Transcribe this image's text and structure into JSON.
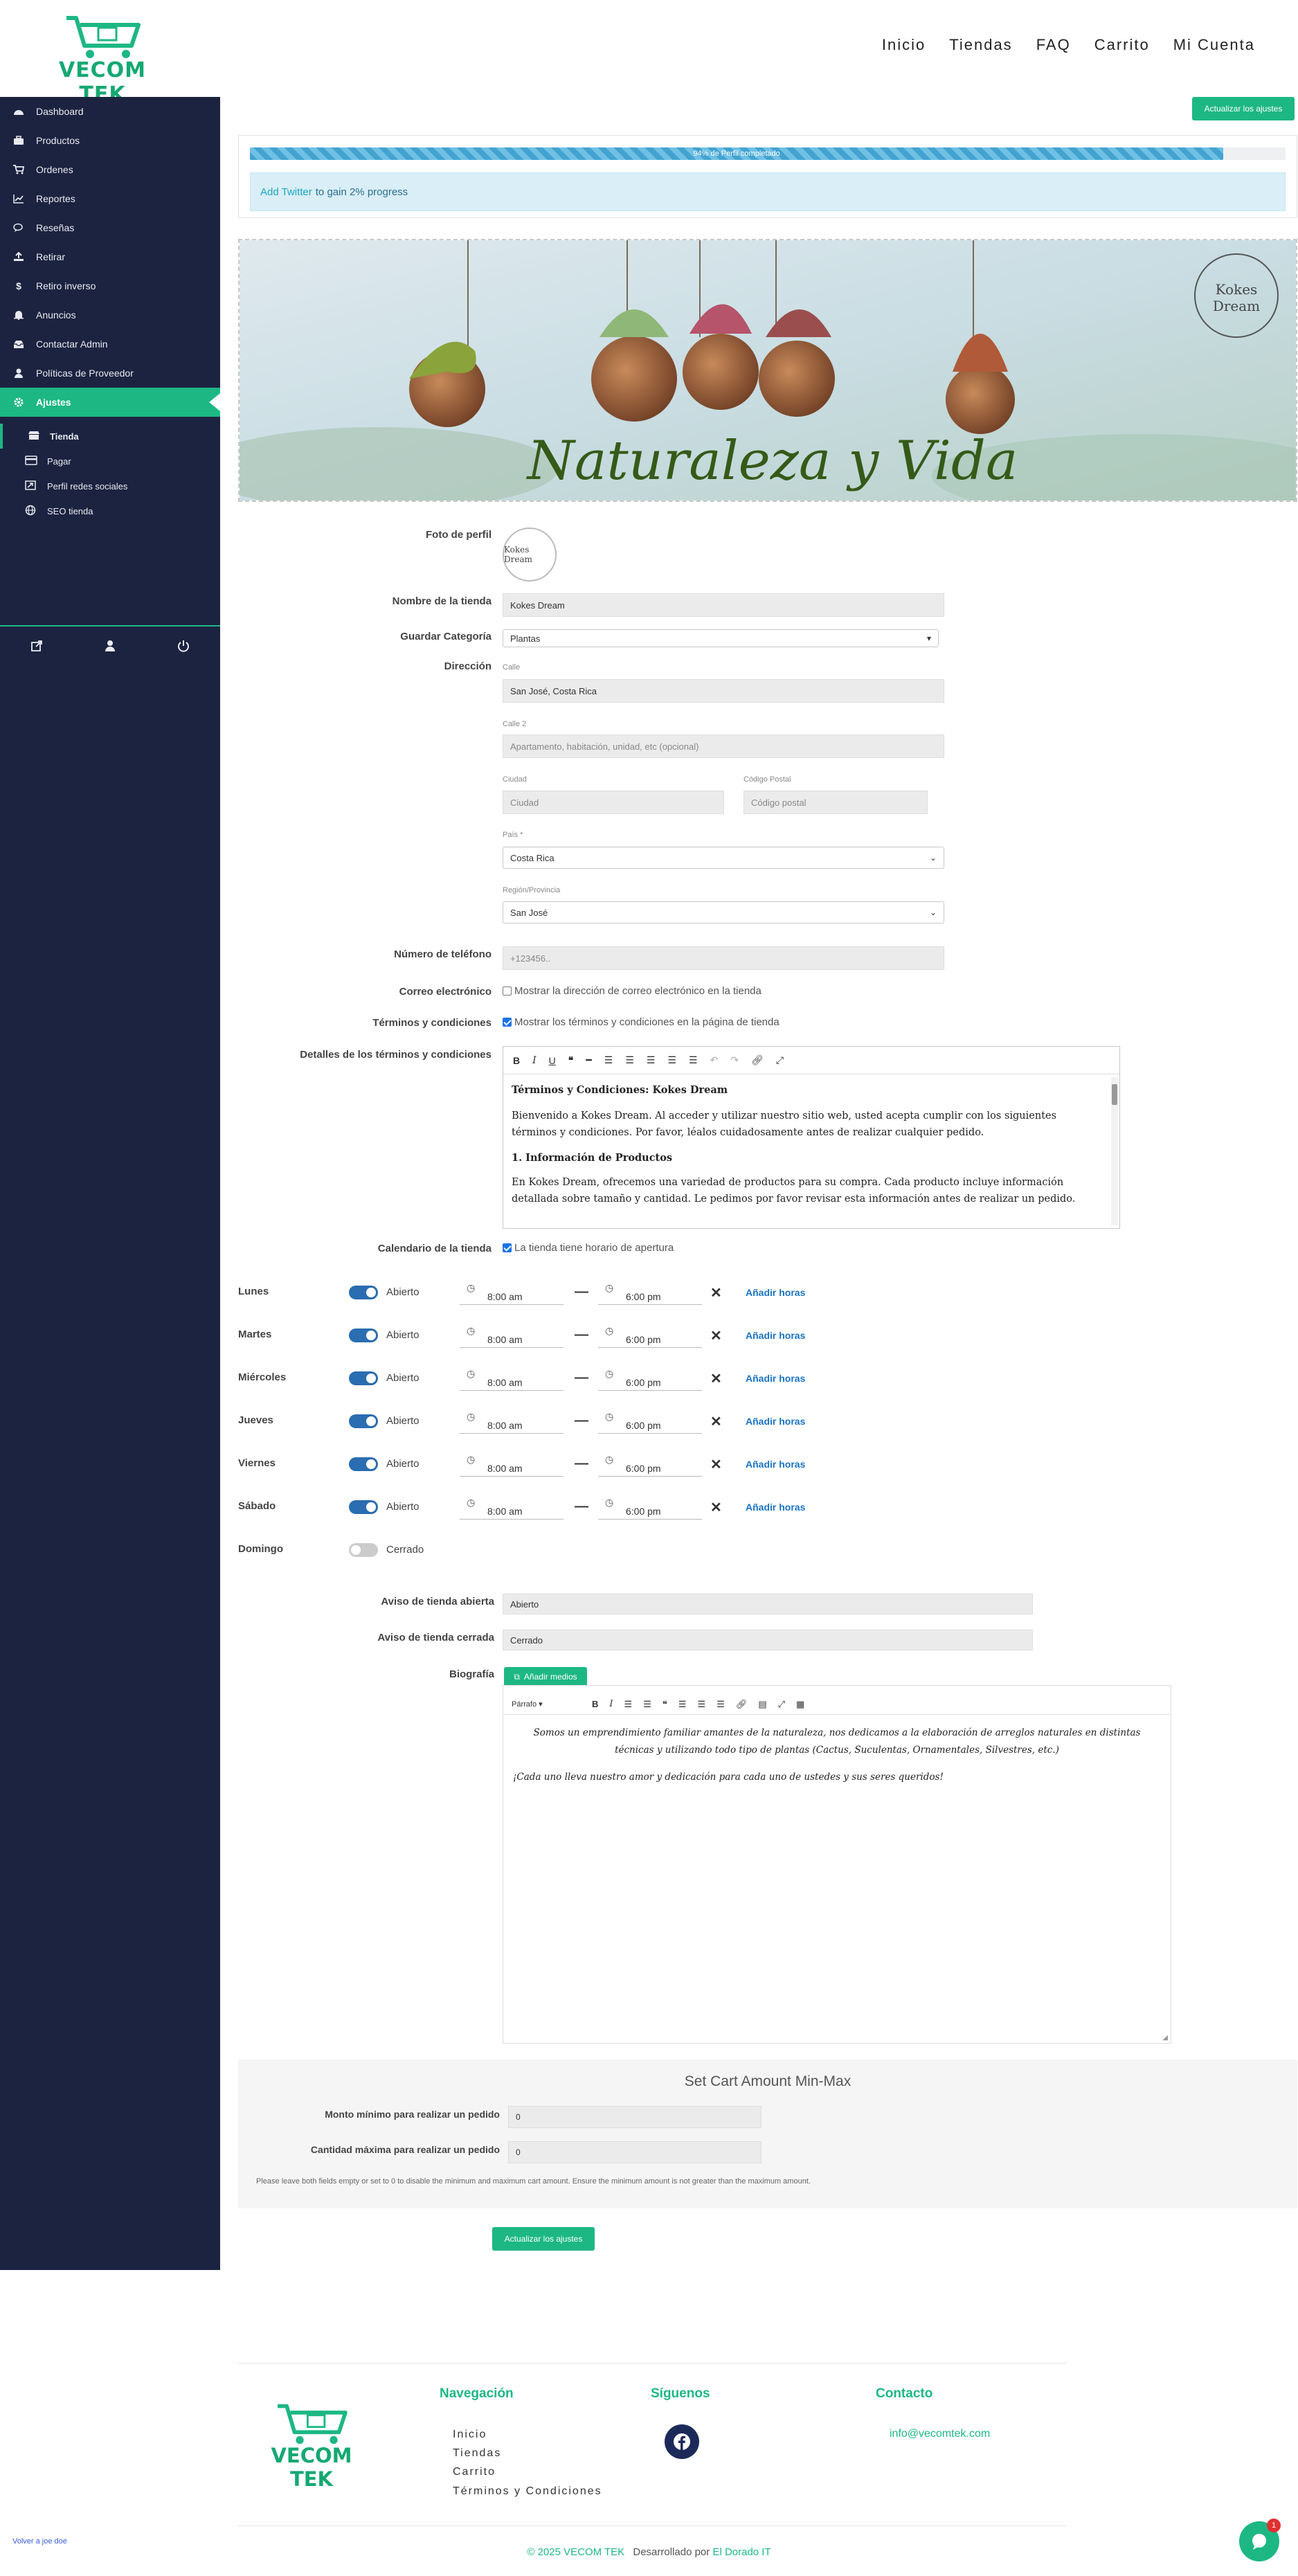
{
  "brand": {
    "name": "VECOM TEK",
    "color": "#1db784"
  },
  "topnav": [
    "Inicio",
    "Tiendas",
    "FAQ",
    "Carrito",
    "Mi Cuenta"
  ],
  "sidebar": {
    "items": [
      {
        "label": "Dashboard",
        "icon": "dashboard-icon"
      },
      {
        "label": "Productos",
        "icon": "briefcase-icon"
      },
      {
        "label": "Ordenes",
        "icon": "cart-icon"
      },
      {
        "label": "Reportes",
        "icon": "line-chart-icon"
      },
      {
        "label": "Reseñas",
        "icon": "comments-icon"
      },
      {
        "label": "Retirar",
        "icon": "upload-icon"
      },
      {
        "label": "Retiro inverso",
        "icon": "dollar-icon"
      },
      {
        "label": "Anuncios",
        "icon": "bell-icon"
      },
      {
        "label": "Contactar Admin",
        "icon": "inbox-icon"
      },
      {
        "label": "Políticas de Proveedor",
        "icon": "user-icon"
      },
      {
        "label": "Ajustes",
        "icon": "gear-icon"
      }
    ],
    "sub_items": [
      {
        "label": "Tienda",
        "icon": "store-icon"
      },
      {
        "label": "Pagar",
        "icon": "credit-card-icon"
      },
      {
        "label": "Perfil redes sociales",
        "icon": "share-icon"
      },
      {
        "label": "SEO tienda",
        "icon": "globe-icon"
      }
    ],
    "footer_icons": [
      "external-link-icon",
      "user-icon",
      "power-icon"
    ]
  },
  "top_button": "Actualizar los ajustes",
  "progress": {
    "percent": 94,
    "label": "94% de Perfil completado",
    "note_link": "Add Twitter",
    "note_text": "to gain 2% progress"
  },
  "banner": {
    "title": "Naturaleza y Vida",
    "logo_text": "Kokes Dream"
  },
  "form": {
    "profile_label": "Foto de perfil",
    "profile_logo": "Kokes Dream",
    "store_name_label": "Nombre de la tienda",
    "store_name": "Kokes Dream",
    "category_label": "Guardar Categoría",
    "category": "Plantas",
    "address_label": "Dirección",
    "street_label": "Calle",
    "street": "San José, Costa Rica",
    "street2_label": "Calle 2",
    "street2_placeholder": "Apartamento, habitación, unidad, etc (opcional)",
    "city_label": "Ciudad",
    "city_placeholder": "Ciudad",
    "zip_label": "Código Postal",
    "zip_placeholder": "Código postal",
    "country_label": "País *",
    "country": "Costa Rica",
    "region_label": "Región/Provincia",
    "region": "San José",
    "phone_label": "Número de teléfono",
    "phone_placeholder": "+123456..",
    "email_label": "Correo electrónico",
    "email_check": "Mostrar la dirección de correo electrónico en la tienda",
    "terms_label": "Términos y condiciones",
    "terms_check": "Mostrar los términos y condiciones en la página de tienda",
    "terms_details_label": "Detalles de los términos y condiciones",
    "terms_body": {
      "h1": "Términos y Condiciones: Kokes Dream",
      "p1": "Bienvenido a Kokes Dream. Al acceder y utilizar nuestro sitio web, usted acepta cumplir con los siguientes términos y condiciones. Por favor, léalos cuidadosamente antes de realizar cualquier pedido.",
      "h2": "1. Información de Productos",
      "p2": "En Kokes Dream, ofrecemos una variedad de productos para su compra. Cada producto incluye información detallada sobre tamaño y cantidad. Le pedimos por favor revisar esta información antes de realizar un pedido."
    },
    "calendar_label": "Calendario de la tienda",
    "calendar_check": "La tienda tiene horario de apertura"
  },
  "schedule": {
    "add_hours": "Añadir horas",
    "days": [
      {
        "name": "Lunes",
        "status": "Abierto",
        "open": true,
        "from": "8:00 am",
        "to": "6:00 pm"
      },
      {
        "name": "Martes",
        "status": "Abierto",
        "open": true,
        "from": "8:00 am",
        "to": "6:00 pm"
      },
      {
        "name": "Miércoles",
        "status": "Abierto",
        "open": true,
        "from": "8:00 am",
        "to": "6:00 pm"
      },
      {
        "name": "Jueves",
        "status": "Abierto",
        "open": true,
        "from": "8:00 am",
        "to": "6:00 pm"
      },
      {
        "name": "Viernes",
        "status": "Abierto",
        "open": true,
        "from": "8:00 am",
        "to": "6:00 pm"
      },
      {
        "name": "Sábado",
        "status": "Abierto",
        "open": true,
        "from": "8:00 am",
        "to": "6:00 pm"
      },
      {
        "name": "Domingo",
        "status": "Cerrado",
        "open": false
      }
    ]
  },
  "notices": {
    "open_label": "Aviso de tienda abierta",
    "open_value": "Abierto",
    "closed_label": "Aviso de tienda cerrada",
    "closed_value": "Cerrado"
  },
  "bio": {
    "label": "Biografía",
    "media_button": "Añadir medios",
    "format": "Párrafo",
    "p1": "Somos un emprendimiento familiar amantes de la naturaleza, nos dedicamos a la elaboración de arreglos naturales en distintas técnicas y utilizando todo tipo de plantas (Cactus, Suculentas, Ornamentales, Silvestres, etc.)",
    "p2": "¡Cada uno lleva nuestro amor y dedicación para cada uno de ustedes y sus seres queridos!"
  },
  "cart": {
    "title": "Set Cart Amount Min-Max",
    "min_label": "Monto mínimo para realizar un pedido",
    "min_value": "0",
    "max_label": "Cantidad máxima para realizar un pedido",
    "max_value": "0",
    "note": "Please leave both fields empty or set to 0 to disable the minimum and maximum cart amount. Ensure the minimum amount is not greater than the maximum amount."
  },
  "bottom_button": "Actualizar los ajustes",
  "footer": {
    "nav_title": "Navegación",
    "nav_links": [
      "Inicio",
      "Tiendas",
      "Carrito",
      "Términos y Condiciones"
    ],
    "follow_title": "Síguenos",
    "contact_title": "Contacto",
    "email": "info@vecomtek.com",
    "copyright": "© 2025 VECOM TEK",
    "dev_text": "Desarrollado por",
    "dev_link": "El Dorado IT",
    "switch_back": "Volver a joe doe",
    "chat_badge": "1"
  }
}
